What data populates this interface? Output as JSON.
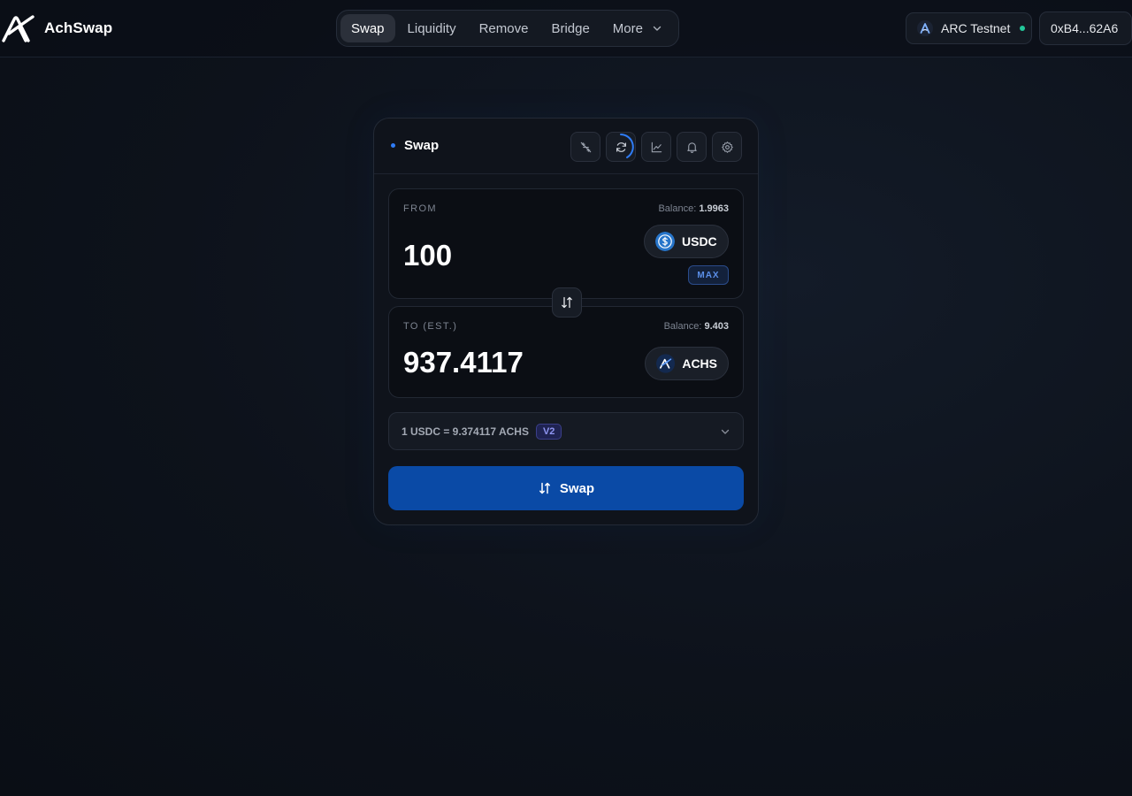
{
  "header": {
    "brand_name": "AchSwap",
    "nav": [
      {
        "label": "Swap",
        "active": true
      },
      {
        "label": "Liquidity",
        "active": false
      },
      {
        "label": "Remove",
        "active": false
      },
      {
        "label": "Bridge",
        "active": false
      },
      {
        "label": "More",
        "active": false
      }
    ],
    "network_label": "ARC Testnet",
    "network_status_color": "#22c79a",
    "wallet_address": "0xB4...62A6"
  },
  "card": {
    "title": "Swap",
    "tools": [
      "no-routing-icon",
      "refresh-icon",
      "chart-icon",
      "bell-icon",
      "gear-icon"
    ],
    "from": {
      "label": "FROM",
      "balance_label": "Balance:",
      "balance_value": "1.9963",
      "amount": "100",
      "token": "USDC",
      "max_label": "MAX"
    },
    "to": {
      "label": "TO (EST.)",
      "balance_label": "Balance:",
      "balance_value": "9.403",
      "amount": "937.4117",
      "token": "ACHS"
    },
    "rate": {
      "text": "1 USDC = 9.374117 ACHS",
      "version": "V2"
    },
    "swap_button": "Swap"
  },
  "colors": {
    "accent": "#0a4aa6",
    "accent_dot": "#2f7cf6",
    "v2_badge": "#8f96f2"
  }
}
